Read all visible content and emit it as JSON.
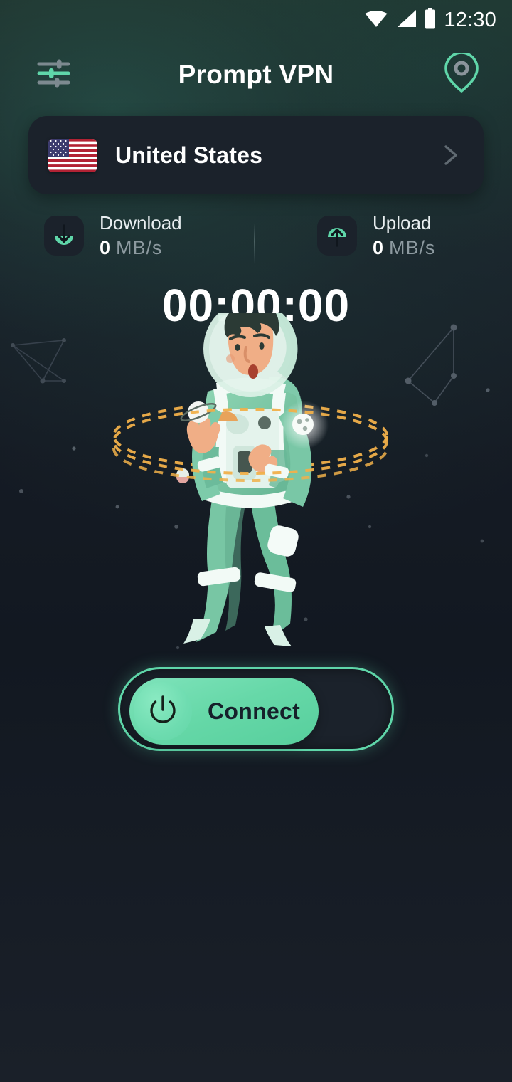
{
  "status_bar": {
    "time": "12:30",
    "icons": [
      "wifi-icon",
      "cellular-signal-icon",
      "battery-icon"
    ]
  },
  "app_bar": {
    "title": "Prompt VPN",
    "left_icon": "settings-sliders-icon",
    "right_icon": "location-pin-icon"
  },
  "server": {
    "country": "United States",
    "flag": "flag-united-states",
    "chevron": "chevron-right-icon"
  },
  "stats": {
    "download": {
      "label": "Download",
      "value": "0",
      "unit": "MB/s",
      "icon": "download-arrow-icon"
    },
    "upload": {
      "label": "Upload",
      "value": "0",
      "unit": "MB/s",
      "icon": "upload-arrow-icon"
    }
  },
  "timer": {
    "elapsed": "00:00:00"
  },
  "illustration": {
    "name": "astronaut-floating-illustration"
  },
  "connect": {
    "label": "Connect",
    "icon": "power-icon",
    "state": "disconnected"
  },
  "colors": {
    "accent_green": "#5fd6a9",
    "accent_green_light": "#7fe3bb",
    "background_dark": "#171d25",
    "card_background": "#1b222b",
    "text_primary": "#ffffff",
    "text_muted": "#8d9aa0",
    "orbit_orange": "#f0b04a"
  }
}
